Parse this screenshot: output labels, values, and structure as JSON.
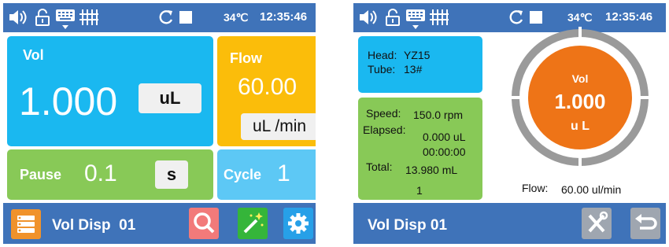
{
  "status_bar": {
    "temperature": "34℃",
    "time": "12:35:46"
  },
  "left_screen": {
    "volume": {
      "label": "Vol",
      "value": "1.000",
      "unit": "uL"
    },
    "flow": {
      "label": "Flow",
      "value": "60.00",
      "unit": "uL /min"
    },
    "pause": {
      "label": "Pause",
      "value": "0.1",
      "unit": "s"
    },
    "cycle": {
      "label": "Cycle",
      "value": "1"
    },
    "mode_title": "Vol Disp  01"
  },
  "right_screen": {
    "head_label": "Head:",
    "head_value": "YZ15",
    "tube_label": "Tube:",
    "tube_value": "13#",
    "speed_label": "Speed:",
    "speed_value": "150.0 rpm",
    "elapsed_label": "Elapsed:",
    "elapsed_volume": "0.000 uL",
    "elapsed_time": "00:00:00",
    "total_label": "Total:",
    "total_value": "13.980 mL",
    "cycle_count": "1",
    "gauge": {
      "label": "Vol",
      "value": "1.000",
      "unit": "u L"
    },
    "flow_label": "Flow:",
    "flow_value": "60.00 ul/min",
    "mode_title": "Vol Disp 01"
  },
  "colors": {
    "bar_blue": "#3f73b9",
    "tile_cyan": "#1ab8f0",
    "tile_yellow": "#fbbd0a",
    "tile_green": "#88c957",
    "tile_lightblue": "#5dc8f5",
    "gauge_orange": "#ee7417",
    "gauge_ring": "#9a9a9a",
    "btn_orange": "#f0922b",
    "btn_red": "#f27a7a",
    "btn_green": "#35b53a",
    "btn_blue": "#27a0e8",
    "btn_grey": "#9fa6b0"
  },
  "icons": [
    "speaker-icon",
    "unlock-icon",
    "keyboard-icon",
    "gate-icon",
    "refresh-icon",
    "stop-icon",
    "list-icon",
    "search-icon",
    "magic-wand-icon",
    "settings-gear-icon",
    "tools-icon",
    "back-arrow-icon"
  ]
}
